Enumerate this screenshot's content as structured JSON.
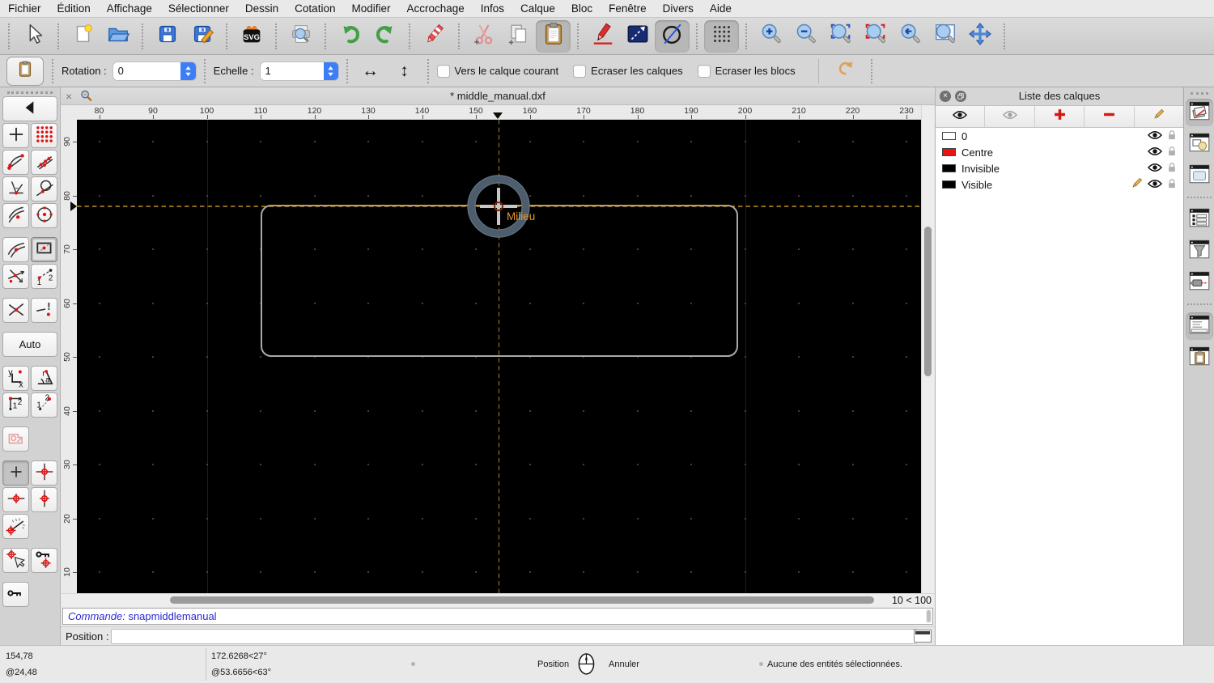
{
  "menu_bar": {
    "items": [
      "Fichier",
      "Édition",
      "Affichage",
      "Sélectionner",
      "Dessin",
      "Cotation",
      "Modifier",
      "Accrochage",
      "Infos",
      "Calque",
      "Bloc",
      "Fenêtre",
      "Divers",
      "Aide"
    ]
  },
  "main_toolbar": {
    "svg_icon_label": "SVG",
    "groups": [
      [
        {
          "name": "cursor-tool-button",
          "icon": "cursor"
        }
      ],
      [
        {
          "name": "new-document-button",
          "icon": "new-document"
        },
        {
          "name": "open-document-button",
          "icon": "open-folder"
        }
      ],
      [
        {
          "name": "save-button",
          "icon": "save"
        },
        {
          "name": "save-as-button",
          "icon": "save-as"
        }
      ],
      [
        {
          "name": "svg-export-button",
          "icon": "svg-export"
        }
      ],
      [
        {
          "name": "print-preview-button",
          "icon": "print-preview"
        }
      ],
      [
        {
          "name": "undo-button",
          "icon": "undo"
        },
        {
          "name": "redo-button",
          "icon": "redo"
        }
      ],
      [
        {
          "name": "delete-button",
          "icon": "eraser"
        }
      ],
      [
        {
          "name": "cut-button",
          "icon": "cut"
        },
        {
          "name": "copy-button",
          "icon": "copy"
        },
        {
          "name": "paste-button",
          "icon": "paste",
          "active": true
        }
      ],
      [
        {
          "name": "pen-attributes-button",
          "icon": "pen-red"
        },
        {
          "name": "line-tool-button",
          "icon": "line-dash-blue"
        },
        {
          "name": "circle-tool-button",
          "icon": "circle-dash",
          "active": true
        }
      ],
      [
        {
          "name": "grid-toggle-button",
          "icon": "grid-toggle",
          "active": true
        }
      ],
      [
        {
          "name": "zoom-in-button",
          "icon": "zoom-in"
        },
        {
          "name": "zoom-out-button",
          "icon": "zoom-out"
        },
        {
          "name": "auto-zoom-button",
          "icon": "zoom-auto"
        },
        {
          "name": "zoom-selection-button",
          "icon": "zoom-selection"
        },
        {
          "name": "previous-view-button",
          "icon": "zoom-previous"
        },
        {
          "name": "zoom-window-button",
          "icon": "zoom-window"
        },
        {
          "name": "pan-button",
          "icon": "pan"
        }
      ]
    ]
  },
  "options_bar": {
    "rotation_label": "Rotation :",
    "rotation_value": "0",
    "scale_label": "Echelle :",
    "scale_value": "1",
    "checkboxes": [
      {
        "label": "Vers le calque courant",
        "checked": false
      },
      {
        "label": "Ecraser les calques",
        "checked": false
      },
      {
        "label": "Ecraser les blocs",
        "checked": false
      }
    ]
  },
  "document": {
    "tab_title": "* middle_manual.dxf"
  },
  "rulers": {
    "horizontal": [
      "80",
      "90",
      "100",
      "110",
      "120",
      "130",
      "140",
      "150",
      "160",
      "170",
      "180",
      "190",
      "200",
      "210",
      "220",
      "230"
    ],
    "vertical": [
      "90",
      "80",
      "70",
      "60",
      "50",
      "40",
      "30",
      "20",
      "10"
    ]
  },
  "canvas": {
    "snap_label": "Milieu",
    "grid_status": "10 < 100"
  },
  "snap_palette": {
    "auto_label": "Auto",
    "rows": [
      {
        "items": [
          {
            "name": "palette-collapse-button",
            "icon": "back",
            "wide": true
          }
        ]
      },
      {
        "items": [
          {
            "name": "snap-free-button",
            "icon": "snap-free"
          },
          {
            "name": "snap-grid-button",
            "icon": "snap-grid"
          }
        ]
      },
      {
        "items": [
          {
            "name": "snap-endpoints-button",
            "icon": "snap-endpoints"
          },
          {
            "name": "snap-on-entity-button",
            "icon": "snap-on-entity"
          }
        ]
      },
      {
        "items": [
          {
            "name": "snap-perpendicular-button",
            "icon": "snap-perpendicular"
          },
          {
            "name": "snap-tangential-button",
            "icon": "snap-tangential"
          }
        ]
      },
      {
        "items": [
          {
            "name": "snap-center-button",
            "icon": "snap-center"
          },
          {
            "name": "snap-circle-center-button",
            "icon": "snap-circle-center"
          }
        ],
        "gap_after": true
      },
      {
        "items": [
          {
            "name": "snap-middle-button",
            "icon": "snap-middle"
          },
          {
            "name": "snap-reference-button",
            "icon": "snap-reference",
            "selected": "recessed"
          }
        ]
      },
      {
        "items": [
          {
            "name": "snap-intersection-auto-button",
            "icon": "snap-intersection-auto"
          },
          {
            "name": "snap-distance-points-button",
            "icon": "snap-distance-points"
          }
        ],
        "gap_after": true
      },
      {
        "items": [
          {
            "name": "snap-intersection-button",
            "icon": "snap-intersection"
          },
          {
            "name": "snap-intersection-manual-button",
            "icon": "snap-intersection-manual"
          }
        ],
        "gap_after": true
      },
      {
        "items": [
          {
            "name": "snap-auto-button",
            "label": "Auto",
            "wide": true
          }
        ],
        "gap_after": true
      },
      {
        "items": [
          {
            "name": "coordinate-cartesian-button",
            "icon": "coordinate-cartesian"
          },
          {
            "name": "coordinate-polar-button",
            "icon": "coordinate-polar"
          }
        ]
      },
      {
        "items": [
          {
            "name": "coordinate-relative-button",
            "icon": "coordinate-relative"
          },
          {
            "name": "coordinate-absolute-button",
            "icon": "coordinate-absolute"
          }
        ],
        "gap_after": true
      },
      {
        "items": [
          {
            "name": "restrict-special-button",
            "icon": "restrict-special"
          }
        ],
        "gap_after": true
      },
      {
        "items": [
          {
            "name": "restrict-off-button",
            "icon": "restrict-off",
            "selected": "flat"
          },
          {
            "name": "restrict-orthogonal-button",
            "icon": "restrict-orthogonal"
          }
        ]
      },
      {
        "items": [
          {
            "name": "restrict-horizontal-button",
            "icon": "restrict-horizontal"
          },
          {
            "name": "restrict-vertical-button",
            "icon": "restrict-vertical"
          }
        ]
      },
      {
        "items": [
          {
            "name": "snap-angle-button",
            "icon": "snap-angle"
          }
        ],
        "gap_after": true
      },
      {
        "items": [
          {
            "name": "set-relative-zero-button",
            "icon": "set-relative-zero"
          },
          {
            "name": "lock-relative-zero-button",
            "icon": "lock-relative-zero"
          }
        ],
        "gap_after": true
      },
      {
        "items": [
          {
            "name": "relative-zero-button",
            "icon": "relative-zero"
          }
        ]
      }
    ]
  },
  "layers_panel": {
    "title": "Liste des calques",
    "toolbar": [
      {
        "name": "show-all-layers-button",
        "icon": "eye"
      },
      {
        "name": "hide-all-layers-button",
        "icon": "eye-gray"
      },
      {
        "name": "add-layer-button",
        "icon": "plus-red"
      },
      {
        "name": "remove-layer-button",
        "icon": "minus-red"
      },
      {
        "name": "edit-layer-button",
        "icon": "pencil"
      }
    ],
    "layers": [
      {
        "name": "0",
        "swatch": "#ffffff",
        "current": false
      },
      {
        "name": "Centre",
        "swatch": "#e81414",
        "current": false
      },
      {
        "name": "Invisible",
        "swatch": "#000000",
        "current": false
      },
      {
        "name": "Visible",
        "swatch": "#000000",
        "current": true
      }
    ]
  },
  "panel_dock": {
    "items": [
      {
        "name": "dock-layer-list",
        "icon": "dock-layer-list",
        "active": true
      },
      {
        "name": "dock-block-list",
        "icon": "dock-block-list"
      },
      {
        "name": "dock-library-browser",
        "icon": "dock-library-browser",
        "sep_after": true
      },
      {
        "name": "dock-property-editor",
        "icon": "dock-property-editor"
      },
      {
        "name": "dock-selection-filter",
        "icon": "dock-selection-filter"
      },
      {
        "name": "dock-command-tool",
        "icon": "dock-command-tool",
        "sep_after": true
      },
      {
        "name": "dock-command-history",
        "icon": "dock-command-history",
        "active": true
      },
      {
        "name": "dock-clipboard-panel",
        "icon": "dock-clipboard"
      }
    ]
  },
  "command_area": {
    "prompt": "Commande:",
    "command": "snapmiddlemanual",
    "position_label": "Position :",
    "position_value": ""
  },
  "status_bar": {
    "abs_coord": "154,78",
    "rel_coord": "@24,48",
    "abs_polar": "172.6268<27°",
    "rel_polar": "@53.6656<63°",
    "left_mouse_label": "Position",
    "right_mouse_label": "Annuler",
    "selection_status": "Aucune des entités sélectionnées."
  },
  "colors": {
    "accent_blue": "#3d7ef8",
    "crosshair": "#8f6c18",
    "entity": "#a9a9a9",
    "entity_highlight": "#b49d76",
    "snap_ring": "#4d5d6b",
    "snap_label": "#e8992e",
    "layer_red": "#e81414",
    "undo_green": "#43a047"
  }
}
